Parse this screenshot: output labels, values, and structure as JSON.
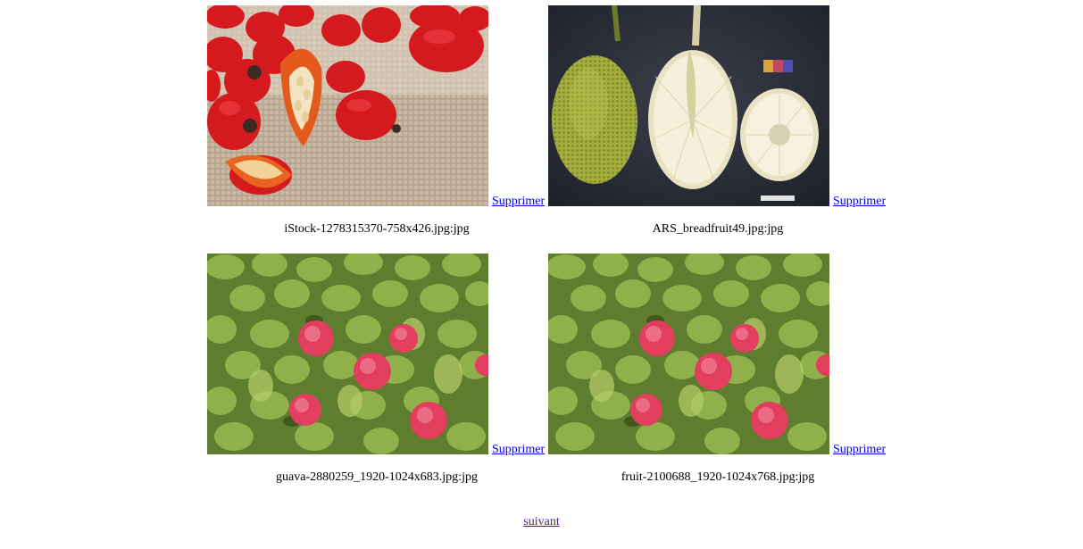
{
  "gallery": {
    "items": [
      {
        "filename": "iStock-1278315370-758x426.jpg:jpg",
        "delete_label": "Supprimer",
        "image": "rosehips-on-burlap"
      },
      {
        "filename": "ARS_breadfruit49.jpg:jpg",
        "delete_label": "Supprimer",
        "image": "breadfruit-cross-section"
      },
      {
        "filename": "guava-2880259_1920-1024x683.jpg:jpg",
        "delete_label": "Supprimer",
        "image": "guava-pile"
      },
      {
        "filename": "fruit-2100688_1920-1024x768.jpg:jpg",
        "delete_label": "Supprimer",
        "image": "guava-pile"
      }
    ]
  },
  "pagination": {
    "next_label": "suivant"
  },
  "colors": {
    "link": "#0000ee",
    "visited_link": "#551a8b"
  }
}
